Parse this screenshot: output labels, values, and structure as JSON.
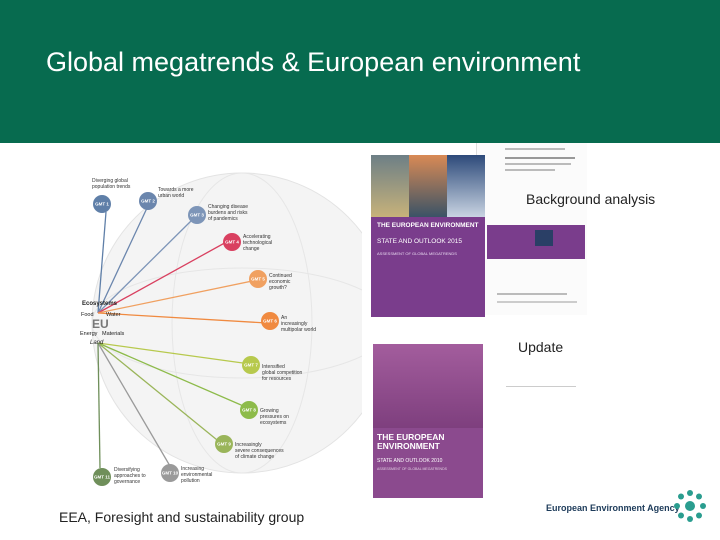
{
  "slide": {
    "title": "Global megatrends & European environment",
    "footer": "EEA, Foresight and sustainability group",
    "background_label": "Background analysis",
    "update_label": "Update",
    "agency": "European Environment Agency"
  },
  "colors": {
    "header": "#076b4f",
    "book_purple": "#7a3d8c"
  },
  "diagram": {
    "hub_label": "EU",
    "resources": [
      "Ecosystems",
      "Food",
      "Water",
      "Energy",
      "Materials",
      "Land"
    ],
    "megatrends": [
      {
        "badge": "GMT 1",
        "text": "Diverging global population trends"
      },
      {
        "badge": "GMT 2",
        "text": "Towards a more urban world"
      },
      {
        "badge": "GMT 3",
        "text": "Changing disease burdens and risks of pandemics"
      },
      {
        "badge": "GMT 4",
        "text": "Accelerating technological change"
      },
      {
        "badge": "GMT 5",
        "text": "Continued economic growth?"
      },
      {
        "badge": "GMT 6",
        "text": "An increasingly multipolar world"
      },
      {
        "badge": "GMT 7",
        "text": "Intensified global competition for resources"
      },
      {
        "badge": "GMT 8",
        "text": "Growing pressures on ecosystems"
      },
      {
        "badge": "GMT 9",
        "text": "Increasingly severe consequences of climate change"
      },
      {
        "badge": "GMT 10",
        "text": "Increasing environmental pollution"
      },
      {
        "badge": "GMT 11",
        "text": "Diversifying approaches to governance"
      }
    ]
  },
  "book1": {
    "title": "THE EUROPEAN ENVIRONMENT",
    "subtitle": "STATE AND OUTLOOK 2015",
    "section": "ASSESSMENT OF GLOBAL MEGATRENDS"
  },
  "book2": {
    "title": "THE EUROPEAN ENVIRONMENT",
    "subtitle": "STATE AND OUTLOOK 2010",
    "section": "ASSESSMENT OF GLOBAL MEGATRENDS"
  }
}
